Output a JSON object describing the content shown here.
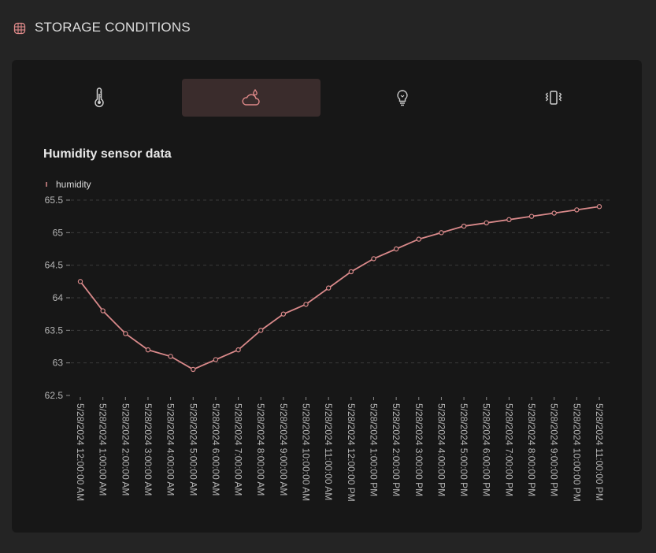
{
  "header": {
    "title": "STORAGE CONDITIONS",
    "icon": "globe-grid-icon"
  },
  "tabs": [
    {
      "icon": "thermometer-icon",
      "active": false
    },
    {
      "icon": "cloud-drop-icon",
      "active": true
    },
    {
      "icon": "lightbulb-icon",
      "active": false
    },
    {
      "icon": "vibration-icon",
      "active": false
    }
  ],
  "colors": {
    "accent": "#e08a8a",
    "line": "#d9898a",
    "active_tab": "#3a2c2c",
    "background": "#242424",
    "card": "#171717"
  },
  "chart_data": {
    "type": "line",
    "title": "Humidity sensor data",
    "legend": "top-left",
    "series": [
      {
        "name": "humidity",
        "values": [
          64.25,
          63.8,
          63.45,
          63.2,
          63.1,
          62.9,
          63.05,
          63.2,
          63.5,
          63.75,
          63.9,
          64.15,
          64.4,
          64.6,
          64.75,
          64.9,
          65.0,
          65.1,
          65.15,
          65.2,
          65.25,
          65.3,
          65.35,
          65.4
        ]
      }
    ],
    "x": [
      "5/28/2024 12:00:00 AM",
      "5/28/2024 1:00:00 AM",
      "5/28/2024 2:00:00 AM",
      "5/28/2024 3:00:00 AM",
      "5/28/2024 4:00:00 AM",
      "5/28/2024 5:00:00 AM",
      "5/28/2024 6:00:00 AM",
      "5/28/2024 7:00:00 AM",
      "5/28/2024 8:00:00 AM",
      "5/28/2024 9:00:00 AM",
      "5/28/2024 10:00:00 AM",
      "5/28/2024 11:00:00 AM",
      "5/28/2024 12:00:00 PM",
      "5/28/2024 1:00:00 PM",
      "5/28/2024 2:00:00 PM",
      "5/28/2024 3:00:00 PM",
      "5/28/2024 4:00:00 PM",
      "5/28/2024 5:00:00 PM",
      "5/28/2024 6:00:00 PM",
      "5/28/2024 7:00:00 PM",
      "5/28/2024 8:00:00 PM",
      "5/28/2024 9:00:00 PM",
      "5/28/2024 10:00:00 PM",
      "5/28/2024 11:00:00 PM"
    ],
    "ylim": [
      62.5,
      65.5
    ],
    "yticks": [
      "62.5",
      "63",
      "63.5",
      "64",
      "64.5",
      "65",
      "65.5"
    ],
    "grid": true
  }
}
